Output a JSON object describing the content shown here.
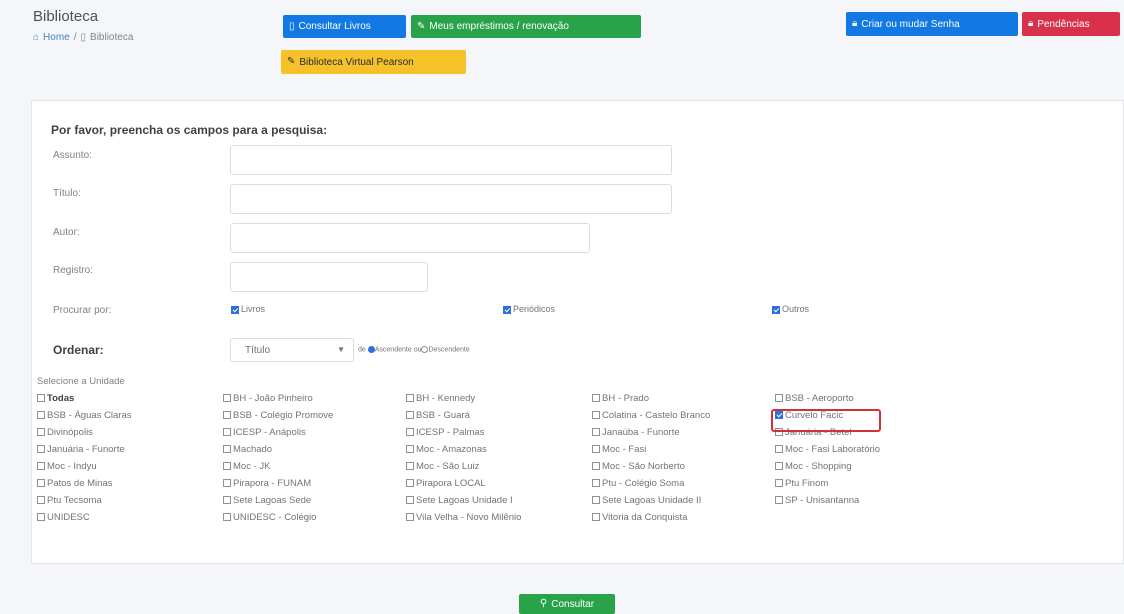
{
  "header": {
    "title": "Biblioteca",
    "breadcrumb_home": "Home",
    "breadcrumb_sep": "/",
    "breadcrumb_current": "Biblioteca"
  },
  "toolbar": {
    "consultar_livros": "Consultar Livros",
    "meus_emprestimos": "Meus empréstimos / renovação",
    "biblioteca_virtual": "Biblioteca Virtual Pearson",
    "criar_senha": "Criar ou mudar Senha",
    "pendencias": "Pendências"
  },
  "form": {
    "title": "Por favor, preencha os campos para a pesquisa:",
    "assunto_label": "Assunto:",
    "assunto_value": "",
    "titulo_label": "Título:",
    "titulo_value": "",
    "autor_label": "Autor:",
    "autor_value": "",
    "registro_label": "Registro:",
    "registro_value": "",
    "procurar_label": "Procurar por:",
    "procurar_options": [
      {
        "label": "Livros",
        "checked": true
      },
      {
        "label": "Periódicos",
        "checked": true
      },
      {
        "label": "Outros",
        "checked": true
      }
    ],
    "ordenar_label": "Ordenar:",
    "ordenar_selected": "Título",
    "ordenar_de": "de",
    "ordenar_asc": "Ascendente",
    "ordenar_ou": "ou",
    "ordenar_desc": "Descendente",
    "unidade_label": "Selecione a Unidade",
    "unidades": [
      [
        "Todas",
        "BH - João Pinheiro",
        "BH - Kennedy",
        "BH - Prado",
        "BSB - Aeroporto"
      ],
      [
        "BSB - Águas Claras",
        "BSB - Colégio Promove",
        "BSB - Guará",
        "Colatina - Castelo Branco",
        "Curvelo Facic"
      ],
      [
        "Divinópolis",
        "ICESP - Anápolis",
        "ICESP - Palmas",
        "Janaúba - Funorte",
        "Januária - Betel"
      ],
      [
        "Januária - Funorte",
        "Machado",
        "Moc - Amazonas",
        "Moc - Fasi",
        "Moc - Fasi Laboratório"
      ],
      [
        "Moc - Indyu",
        "Moc - JK",
        "Moc - São Luiz",
        "Moc - São Norberto",
        "Moc - Shopping"
      ],
      [
        "Patos de Minas",
        "Pirapora - FUNAM",
        "Pirapora LOCAL",
        "Ptu - Colégio Soma",
        "Ptu Finom"
      ],
      [
        "Ptu Tecsoma",
        "Sete Lagoas Sede",
        "Sete Lagoas Unidade I",
        "Sete Lagoas Unidade II",
        "SP - Unisantanna"
      ],
      [
        "UNIDESC",
        "UNIDESC - Colégio",
        "Vila Velha - Novo Milênio",
        "Vitoria da Conquista",
        ""
      ]
    ],
    "checked_unidade": "Curvelo Facic",
    "submit_label": "Consultar"
  },
  "colors": {
    "primary": "#1278e3",
    "success": "#29a34a",
    "warning": "#f7c229",
    "danger": "#d9314c",
    "highlight": "#d1323a"
  }
}
